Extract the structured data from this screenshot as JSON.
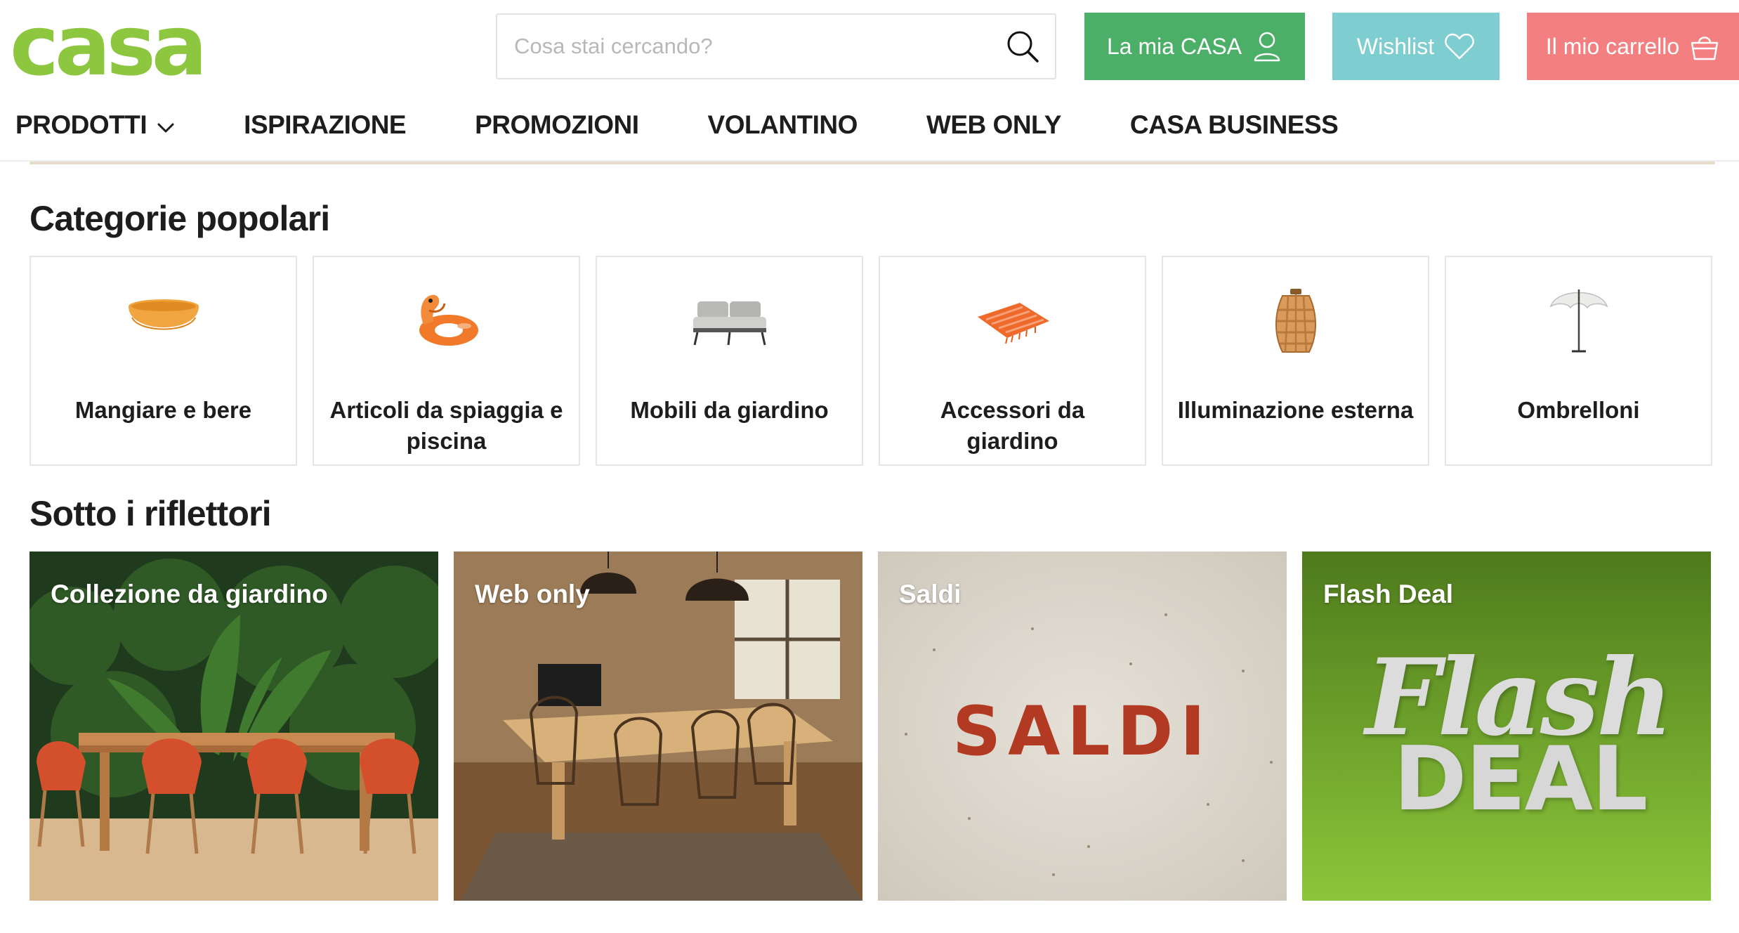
{
  "header": {
    "logo_text": "casa",
    "search": {
      "placeholder": "Cosa stai cercando?",
      "value": "",
      "icon": "search-icon"
    },
    "account_button": {
      "label": "La mia CASA",
      "icon": "user-icon",
      "color": "#4caf68"
    },
    "wishlist_button": {
      "label": "Wishlist",
      "icon": "heart-icon",
      "color": "#7ecdd0"
    },
    "cart_button": {
      "label": "Il mio carrello",
      "icon": "basket-icon",
      "color": "#f47f80"
    },
    "brand_color": "#8dc63f"
  },
  "nav": {
    "items": [
      {
        "label": "PRODOTTI",
        "has_dropdown": true
      },
      {
        "label": "ISPIRAZIONE"
      },
      {
        "label": "PROMOZIONI"
      },
      {
        "label": "VOLANTINO"
      },
      {
        "label": "WEB ONLY"
      },
      {
        "label": "CASA BUSINESS"
      }
    ]
  },
  "categories": {
    "title": "Categorie popolari",
    "items": [
      {
        "label": "Mangiare e bere",
        "icon": "bowl-icon"
      },
      {
        "label": "Articoli da spiaggia e piscina",
        "icon": "pool-float-icon"
      },
      {
        "label": "Mobili da giardino",
        "icon": "garden-sofa-icon"
      },
      {
        "label": "Accessori da giardino",
        "icon": "throw-blanket-icon"
      },
      {
        "label": "Illuminazione esterna",
        "icon": "lantern-icon"
      },
      {
        "label": "Ombrelloni",
        "icon": "parasol-icon"
      }
    ]
  },
  "spotlight": {
    "title": "Sotto i riflettori",
    "items": [
      {
        "label": "Collezione da giardino"
      },
      {
        "label": "Web only"
      },
      {
        "label": "Saldi",
        "banner_text": "SALDI"
      },
      {
        "label": "Flash Deal",
        "banner_script": "Flash",
        "banner_block": "DEAL"
      }
    ]
  }
}
